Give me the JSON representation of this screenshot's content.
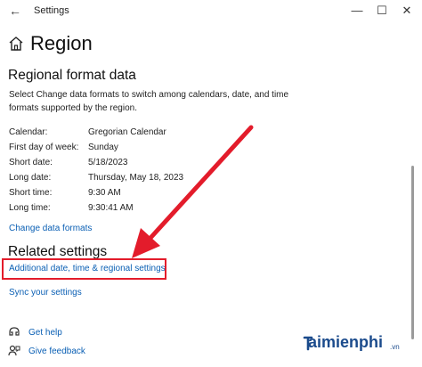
{
  "window": {
    "title": "Settings",
    "back_icon": "arrow-left-icon",
    "minimize_icon": "minimize-icon",
    "maximize_icon": "maximize-icon",
    "close_icon": "close-icon",
    "back_glyph": "←",
    "min_glyph": "—",
    "max_glyph": "☐",
    "close_glyph": "✕"
  },
  "page": {
    "title": "Region",
    "title_icon": "home-icon"
  },
  "regional_format": {
    "heading": "Regional format data",
    "description": "Select Change data formats to switch among calendars, date, and time formats supported by the region.",
    "rows": [
      {
        "label": "Calendar:",
        "value": "Gregorian Calendar"
      },
      {
        "label": "First day of week:",
        "value": "Sunday"
      },
      {
        "label": "Short date:",
        "value": "5/18/2023"
      },
      {
        "label": "Long date:",
        "value": "Thursday, May 18, 2023"
      },
      {
        "label": "Short time:",
        "value": "9:30 AM"
      },
      {
        "label": "Long time:",
        "value": "9:30:41 AM"
      }
    ],
    "change_link": "Change data formats"
  },
  "related": {
    "heading": "Related settings",
    "additional_link": "Additional date, time & regional settings",
    "sync_link": "Sync your settings"
  },
  "footer": {
    "help_link": "Get help",
    "feedback_link": "Give feedback",
    "help_icon": "help-icon",
    "feedback_icon": "feedback-icon"
  },
  "annotation": {
    "arrow_color": "#e31c2b",
    "highlight_color": "#e31c2b"
  },
  "watermark": {
    "text": "aimienphi",
    "suffix": ".vn",
    "icon": "taimienphi-logo-icon"
  }
}
